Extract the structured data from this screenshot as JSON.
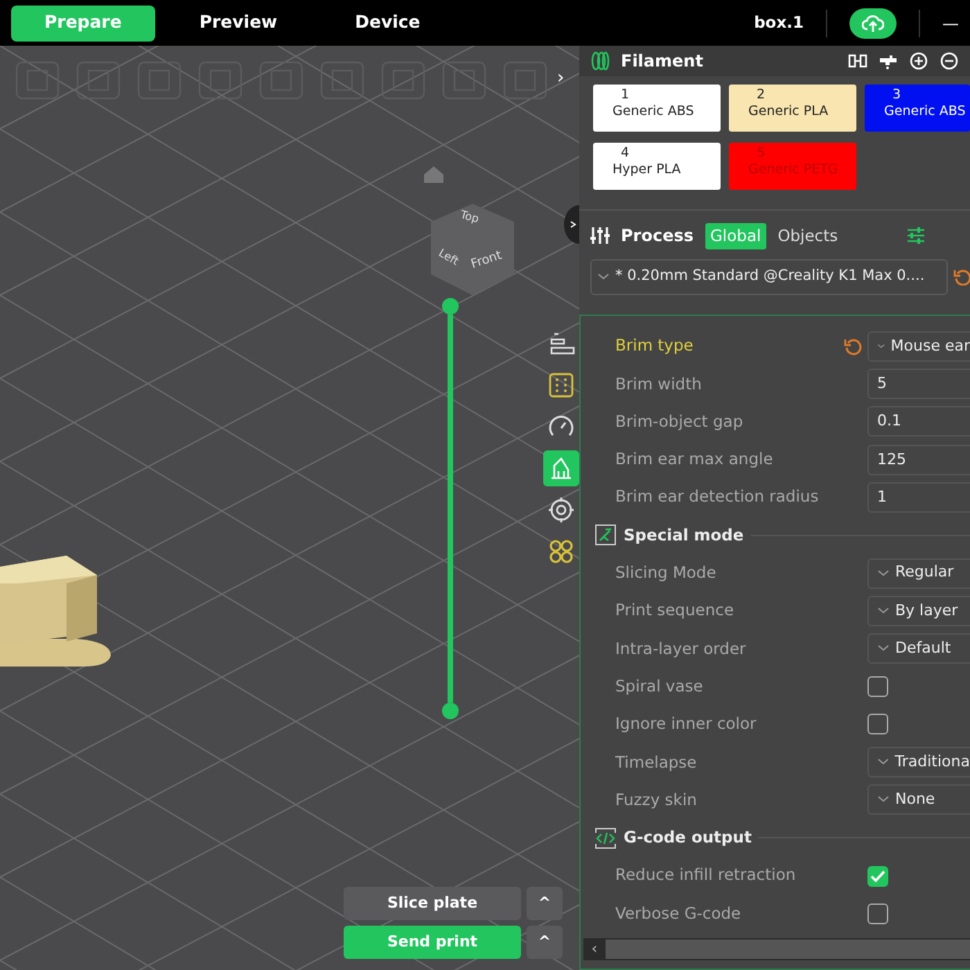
{
  "tabs": [
    {
      "label": "Prepare",
      "selected": true
    },
    {
      "label": "Preview",
      "selected": false
    },
    {
      "label": "Device",
      "selected": false
    }
  ],
  "project_name": "box.1",
  "window_controls": [
    "—"
  ],
  "viewport": {
    "collapse_toolbar": "›",
    "view_cube": [
      "Top",
      "Left",
      "Front"
    ],
    "side_tools": [
      {
        "kind": "layers",
        "selected": false
      },
      {
        "kind": "grid",
        "selected": false
      },
      {
        "kind": "gauge",
        "selected": false
      },
      {
        "kind": "support",
        "selected": true
      },
      {
        "kind": "target",
        "selected": false
      },
      {
        "kind": "clover",
        "selected": false
      }
    ],
    "layer_range": {
      "level": 1
    },
    "actions": [
      {
        "label": "Slice plate",
        "primary": false,
        "caret": "^"
      },
      {
        "label": "Send print",
        "primary": true,
        "caret": "^"
      }
    ]
  },
  "filament": {
    "title": "Filament",
    "slots": [
      {
        "number": "1",
        "name": "Generic ABS",
        "color": "#ffffff"
      },
      {
        "number": "2",
        "name": "Generic PLA",
        "color": "#f8e5b0"
      },
      {
        "number": "3",
        "name": "Generic ABS",
        "color": "#0010f0"
      },
      {
        "number": "4",
        "name": "Hyper PLA",
        "color": "#ffffff"
      },
      {
        "number": "5",
        "name": "Generic PETG",
        "color": "#ff0000"
      }
    ]
  },
  "process": {
    "title": "Process",
    "scopes": [
      {
        "label": "Global",
        "selected": true
      },
      {
        "label": "Objects",
        "selected": false
      }
    ],
    "preset": "* 0.20mm Standard @Creality K1 Max 0....",
    "settings": [
      {
        "kind": "dropdown",
        "label": "Brim type",
        "value": "Mouse ear",
        "modified": true
      },
      {
        "kind": "number",
        "label": "Brim width",
        "value": "5",
        "modified": false
      },
      {
        "kind": "number",
        "label": "Brim-object gap",
        "value": "0.1",
        "modified": false
      },
      {
        "kind": "number",
        "label": "Brim ear max angle",
        "value": "125",
        "modified": false
      },
      {
        "kind": "number",
        "label": "Brim ear detection radius",
        "value": "1",
        "modified": false
      },
      {
        "kind": "section",
        "label": "Special mode"
      },
      {
        "kind": "dropdown",
        "label": "Slicing Mode",
        "value": "Regular",
        "modified": false
      },
      {
        "kind": "dropdown",
        "label": "Print sequence",
        "value": "By layer",
        "modified": false
      },
      {
        "kind": "dropdown",
        "label": "Intra-layer order",
        "value": "Default",
        "modified": false
      },
      {
        "kind": "checkbox",
        "label": "Spiral vase",
        "checked": false
      },
      {
        "kind": "checkbox",
        "label": "Ignore inner color",
        "checked": false
      },
      {
        "kind": "dropdown",
        "label": "Timelapse",
        "value": "Traditiona",
        "modified": false
      },
      {
        "kind": "dropdown",
        "label": "Fuzzy skin",
        "value": "None",
        "modified": false
      },
      {
        "kind": "section",
        "label": "G-code output"
      },
      {
        "kind": "checkbox",
        "label": "Reduce infill retraction",
        "checked": true
      },
      {
        "kind": "checkbox",
        "label": "Verbose G-code",
        "checked": false
      }
    ],
    "scroll_left": "‹"
  }
}
